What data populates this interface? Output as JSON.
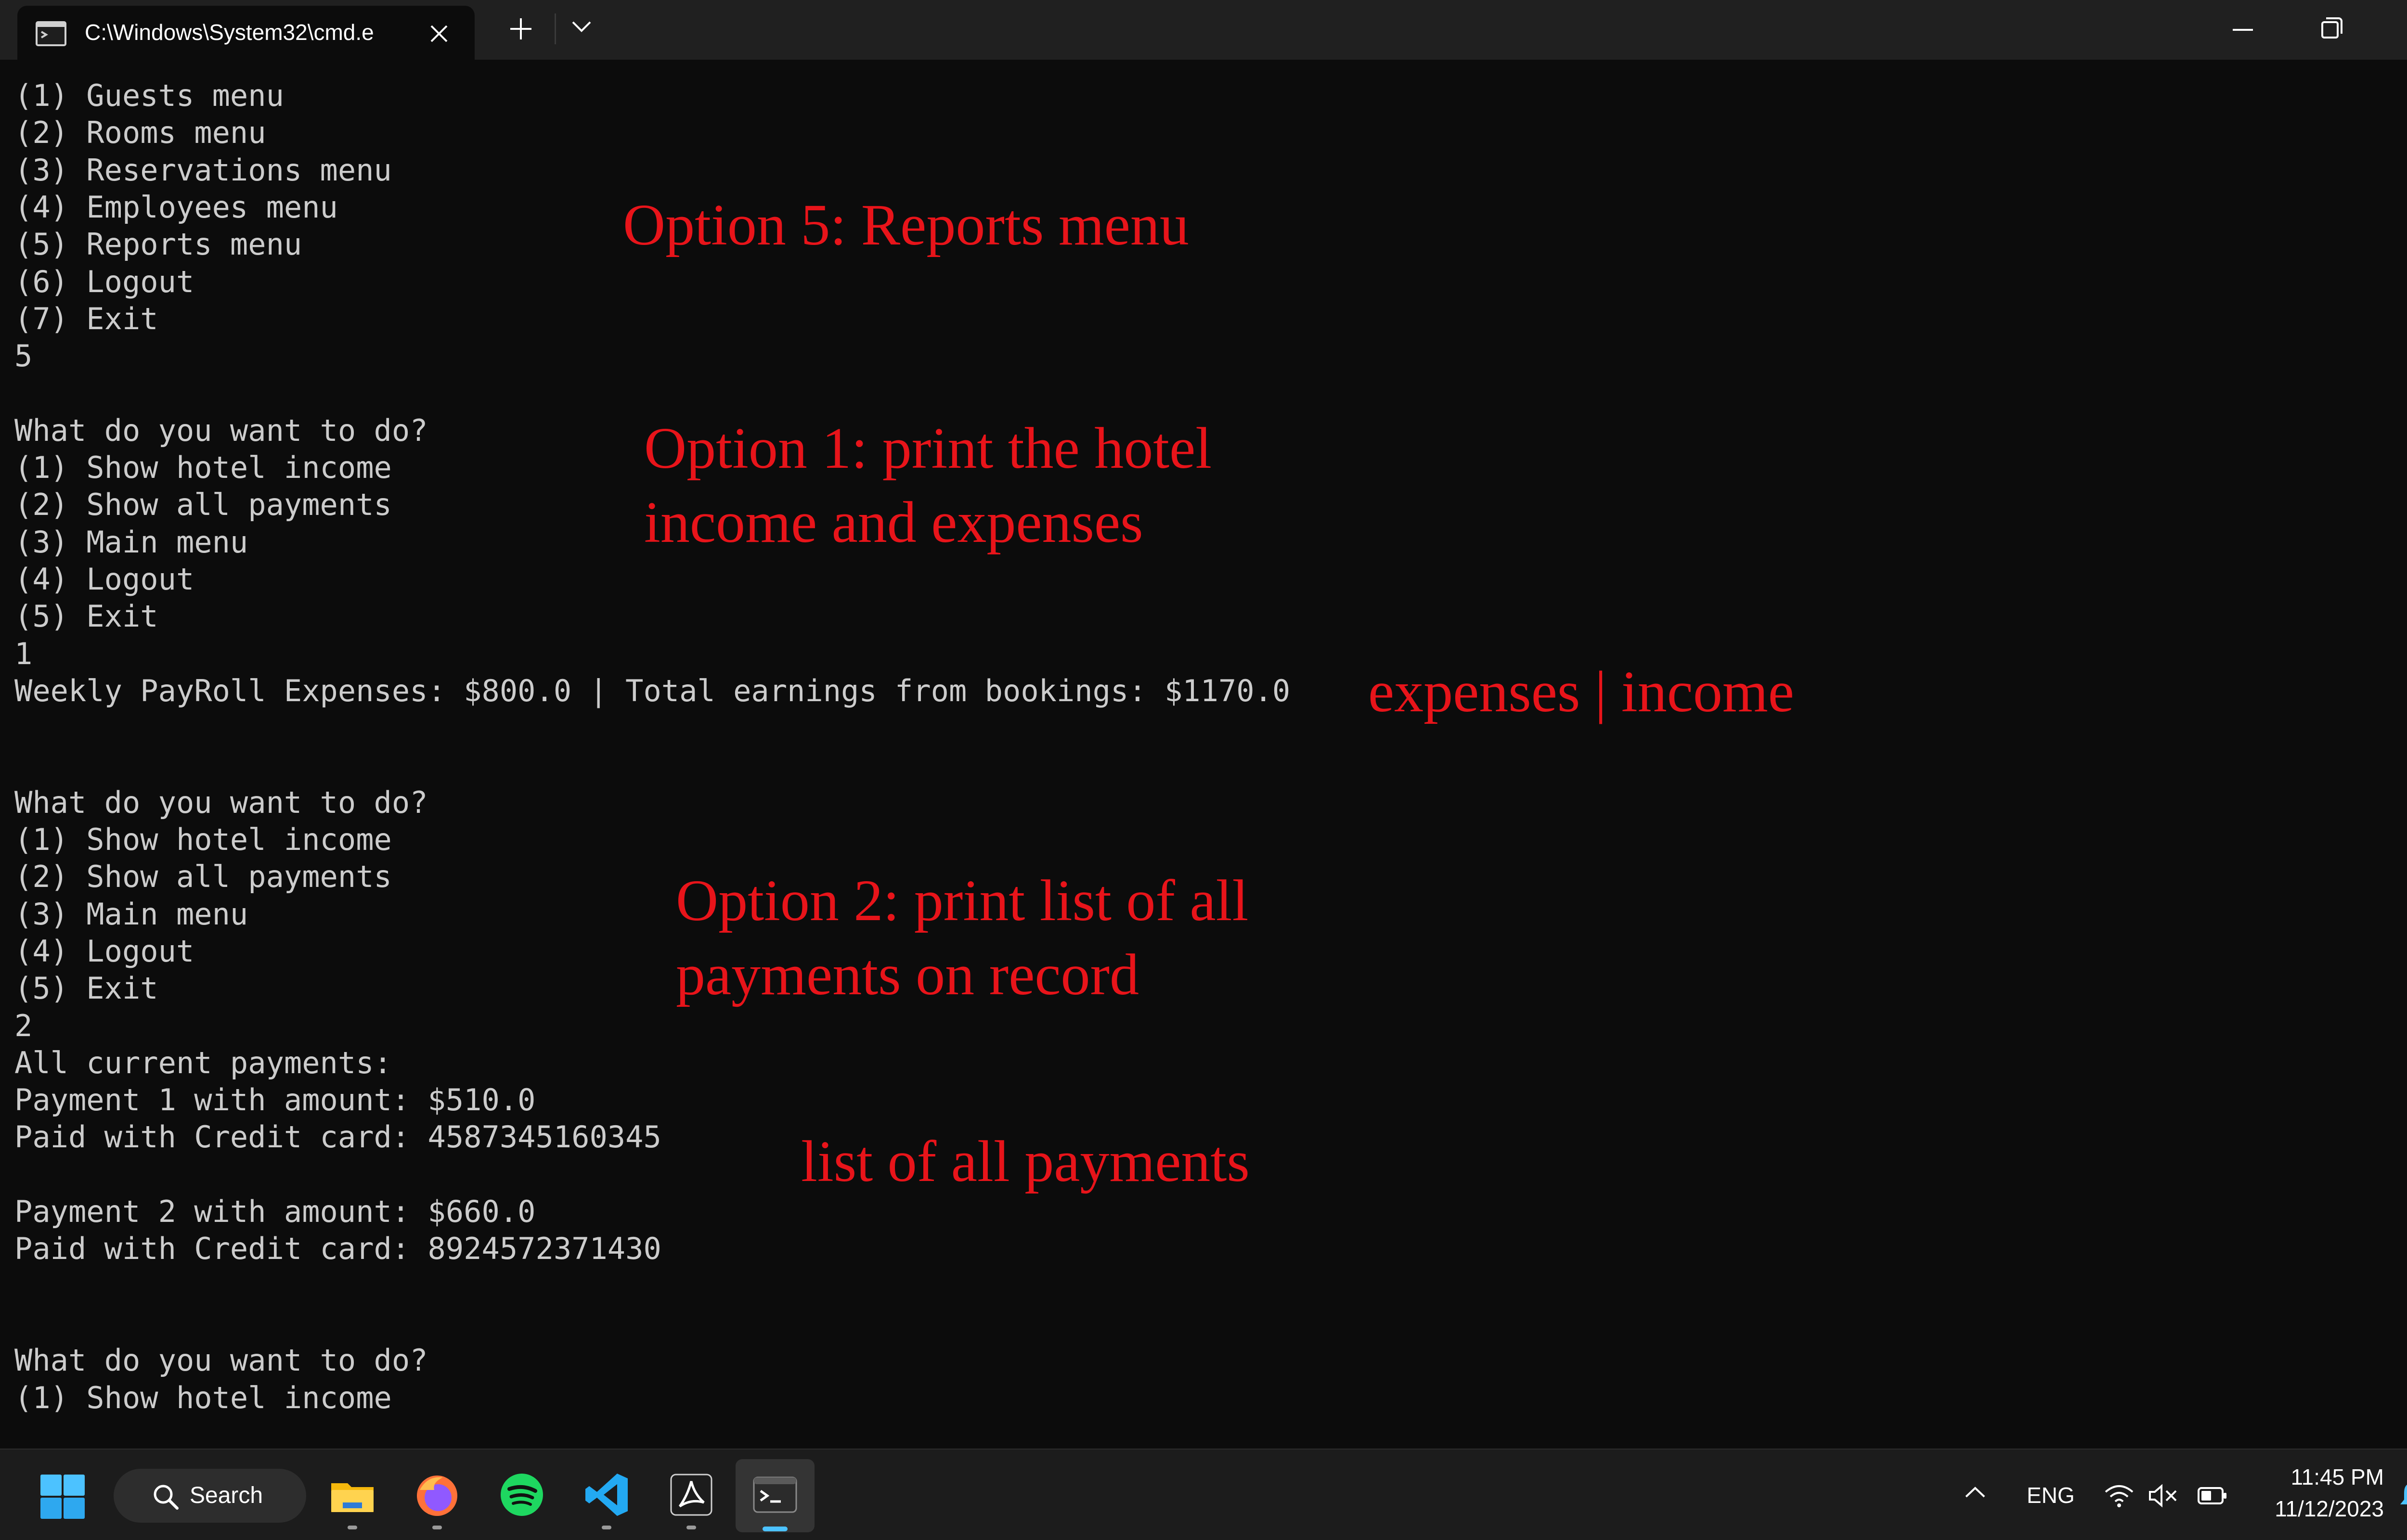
{
  "window": {
    "tab_title": "C:\\Windows\\System32\\cmd.e",
    "tab_icon": "cmd-icon",
    "buttons": [
      "close-icon",
      "plus-icon",
      "chevron-down-icon",
      "minimize-icon",
      "restore-icon",
      "close-icon"
    ]
  },
  "terminal": {
    "lines": [
      "(1) Guests menu",
      "(2) Rooms menu",
      "(3) Reservations menu",
      "(4) Employees menu",
      "(5) Reports menu",
      "(6) Logout",
      "(7) Exit",
      "5",
      "",
      "What do you want to do?",
      "(1) Show hotel income",
      "(2) Show all payments",
      "(3) Main menu",
      "(4) Logout",
      "(5) Exit",
      "1",
      "Weekly PayRoll Expenses: $800.0 | Total earnings from bookings: $1170.0",
      "",
      "",
      "What do you want to do?",
      "(1) Show hotel income",
      "(2) Show all payments",
      "(3) Main menu",
      "(4) Logout",
      "(5) Exit",
      "2",
      "All current payments:",
      "Payment 1 with amount: $510.0",
      "Paid with Credit card: 4587345160345",
      "",
      "Payment 2 with amount: $660.0",
      "Paid with Credit card: 8924572371430",
      "",
      "",
      "What do you want to do?",
      "(1) Show hotel income"
    ],
    "text_color": "#cccccc",
    "background": "#0c0c0c"
  },
  "annotations": {
    "color": "#e8141a",
    "option5": "Option 5: Reports menu",
    "option1_line1": "Option 1: print the hotel",
    "option1_line2": "income and expenses",
    "expenses_income": "expenses | income",
    "option2_line1": "Option 2: print list of all",
    "option2_line2": "payments on record",
    "list_payments": "list of all payments"
  },
  "taskbar": {
    "search_label": "Search",
    "apps": [
      "file-explorer-icon",
      "firefox-icon",
      "spotify-icon",
      "vscode-icon",
      "acrobat-icon",
      "terminal-icon"
    ],
    "active_app": "terminal-icon",
    "language": "ENG",
    "time": "11:45 PM",
    "date": "11/12/2023",
    "accent": "#4cc2ff"
  }
}
